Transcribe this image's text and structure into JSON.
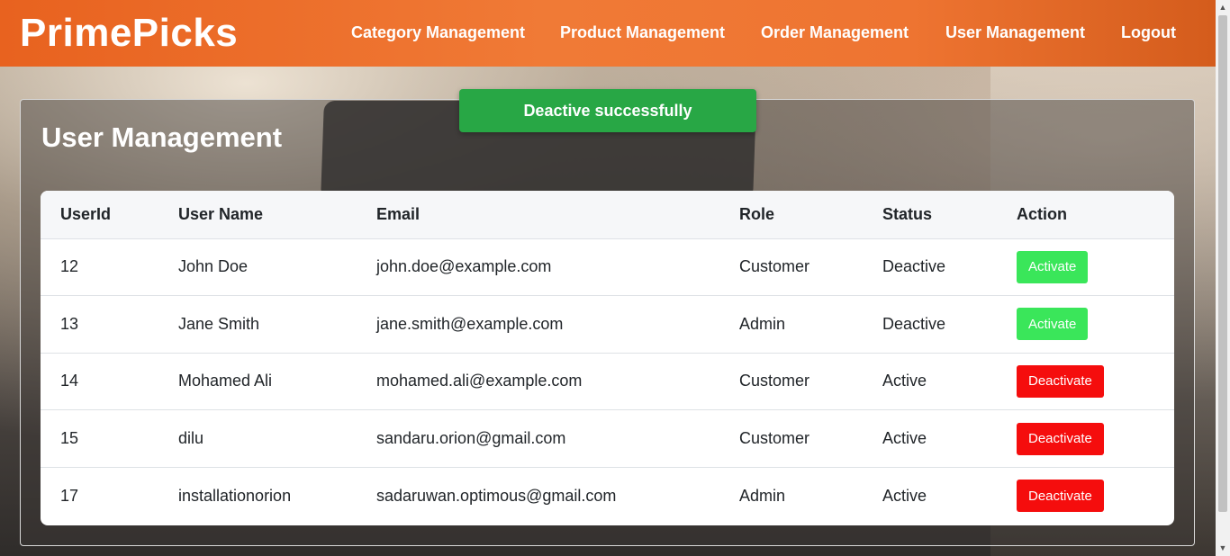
{
  "brand": "PrimePicks",
  "nav": {
    "category": "Category Management",
    "product": "Product Management",
    "order": "Order Management",
    "user": "User Management",
    "logout": "Logout"
  },
  "toast": "Deactive successfully",
  "page_title": "User Management",
  "table": {
    "headers": [
      "UserId",
      "User Name",
      "Email",
      "Role",
      "Status",
      "Action"
    ],
    "rows": [
      {
        "id": "12",
        "name": "John Doe",
        "email": "john.doe@example.com",
        "role": "Customer",
        "status": "Deactive",
        "action": "Activate"
      },
      {
        "id": "13",
        "name": "Jane Smith",
        "email": "jane.smith@example.com",
        "role": "Admin",
        "status": "Deactive",
        "action": "Activate"
      },
      {
        "id": "14",
        "name": "Mohamed Ali",
        "email": "mohamed.ali@example.com",
        "role": "Customer",
        "status": "Active",
        "action": "Deactivate"
      },
      {
        "id": "15",
        "name": "dilu",
        "email": "sandaru.orion@gmail.com",
        "role": "Customer",
        "status": "Active",
        "action": "Deactivate"
      },
      {
        "id": "17",
        "name": "installationorion",
        "email": "sadaruwan.optimous@gmail.com",
        "role": "Admin",
        "status": "Active",
        "action": "Deactivate"
      }
    ]
  },
  "colors": {
    "navbar": "#ee7431",
    "toast": "#28a745",
    "activate": "#3ae65a",
    "deactivate": "#f50d0d"
  },
  "icons": {
    "scroll_up": "scroll-up-arrow-icon",
    "scroll_down": "scroll-down-arrow-icon"
  }
}
